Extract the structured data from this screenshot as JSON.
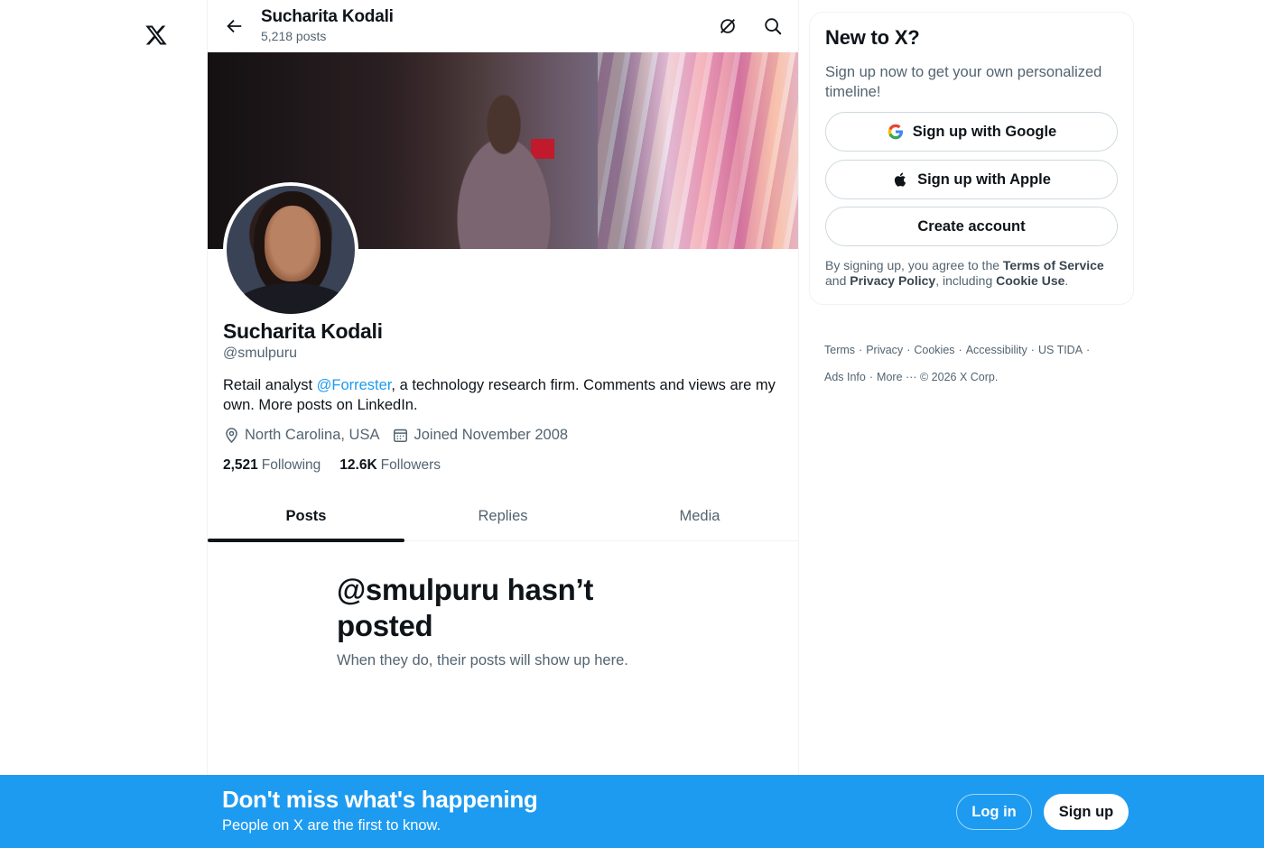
{
  "header": {
    "name": "Sucharita Kodali",
    "posts": "5,218 posts"
  },
  "profile": {
    "name": "Sucharita Kodali",
    "handle": "@smulpuru",
    "bio_before": "Retail analyst ",
    "bio_mention": "@Forrester",
    "bio_after": ", a technology research firm. Comments and views are my own. More posts on LinkedIn.",
    "location": "North Carolina, USA",
    "joined": "Joined November 2008",
    "following_count": "2,521",
    "following_label": "Following",
    "followers_count": "12.6K",
    "followers_label": "Followers"
  },
  "tabs": [
    {
      "label": "Posts",
      "active": true
    },
    {
      "label": "Replies",
      "active": false
    },
    {
      "label": "Media",
      "active": false
    }
  ],
  "empty_state": {
    "title": "@smulpuru hasn’t posted",
    "subtitle": "When they do, their posts will show up here."
  },
  "signup_card": {
    "title": "New to X?",
    "subtitle": "Sign up now to get your own personalized timeline!",
    "google_label": "Sign up with Google",
    "apple_label": "Sign up with Apple",
    "create_label": "Create account",
    "terms_prefix": "By signing up, you agree to the ",
    "terms_link": "Terms of Service",
    "terms_and": " and ",
    "privacy_link": "Privacy Policy",
    "terms_including": ", including ",
    "cookie_link": "Cookie Use",
    "terms_end": "."
  },
  "footer": {
    "terms": "Terms",
    "privacy": "Privacy",
    "cookies": "Cookies",
    "accessibility": "Accessibility",
    "ustida": "US TIDA",
    "ads_info": "Ads Info",
    "more": "More ···",
    "copyright": "© 2026 X Corp."
  },
  "bottom_bar": {
    "title": "Don't miss what's happening",
    "subtitle": "People on X are the first to know.",
    "login_label": "Log in",
    "signup_label": "Sign up"
  },
  "colors": {
    "accent": "#1d9bf0",
    "text_primary": "#0f1419",
    "text_secondary": "#536471"
  },
  "icons": {
    "logo": "x-logo-icon",
    "back": "arrow-left-icon",
    "hide": "eye-slash-icon",
    "search": "search-icon",
    "location": "location-pin-icon",
    "calendar": "calendar-icon",
    "google": "google-icon",
    "apple": "apple-icon"
  }
}
